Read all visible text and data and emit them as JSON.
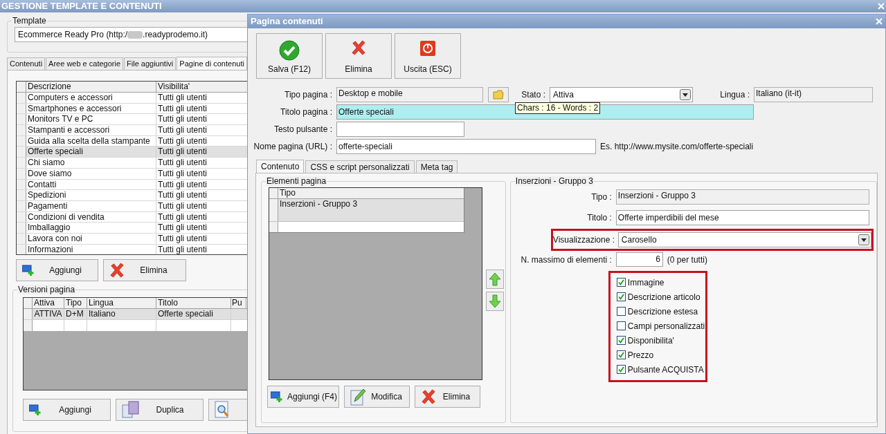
{
  "main_window": {
    "title": "GESTIONE TEMPLATE E CONTENUTI",
    "template": {
      "legend": "Template",
      "value_prefix": "Ecommerce Ready Pro (http:/",
      "value_suffix": ".readyprodemo.it)"
    },
    "tabs": [
      {
        "label": "Contenuti",
        "selected": false
      },
      {
        "label": "Aree web e categorie",
        "selected": false
      },
      {
        "label": "File aggiuntivi",
        "selected": false
      },
      {
        "label": "Pagine di contenuti",
        "selected": true
      }
    ],
    "pages_table": {
      "columns": [
        "Descrizione",
        "Visibilita'"
      ],
      "rows": [
        {
          "cells": [
            "Computers e accessori",
            "Tutti gli utenti"
          ],
          "selected": false
        },
        {
          "cells": [
            "Smartphones e accessori",
            "Tutti gli utenti"
          ],
          "selected": false
        },
        {
          "cells": [
            "Monitors TV e PC",
            "Tutti gli utenti"
          ],
          "selected": false
        },
        {
          "cells": [
            "Stampanti e accessori",
            "Tutti gli utenti"
          ],
          "selected": false
        },
        {
          "cells": [
            "Guida alla scelta della stampante",
            "Tutti gli utenti"
          ],
          "selected": false
        },
        {
          "cells": [
            "Offerte speciali",
            "Tutti gli utenti"
          ],
          "selected": true
        },
        {
          "cells": [
            "Chi siamo",
            "Tutti gli utenti"
          ],
          "selected": false
        },
        {
          "cells": [
            "Dove siamo",
            "Tutti gli utenti"
          ],
          "selected": false
        },
        {
          "cells": [
            "Contatti",
            "Tutti gli utenti"
          ],
          "selected": false
        },
        {
          "cells": [
            "Spedizioni",
            "Tutti gli utenti"
          ],
          "selected": false
        },
        {
          "cells": [
            "Pagamenti",
            "Tutti gli utenti"
          ],
          "selected": false
        },
        {
          "cells": [
            "Condizioni di vendita",
            "Tutti gli utenti"
          ],
          "selected": false
        },
        {
          "cells": [
            "Imballaggio",
            "Tutti gli utenti"
          ],
          "selected": false
        },
        {
          "cells": [
            "Lavora con noi",
            "Tutti gli utenti"
          ],
          "selected": false
        },
        {
          "cells": [
            "Informazioni",
            "Tutti gli utenti"
          ],
          "selected": false
        }
      ]
    },
    "page_buttons": [
      {
        "kind": "add",
        "label": "Aggiungi"
      },
      {
        "kind": "delete",
        "label": "Elimina"
      }
    ],
    "versions": {
      "legend": "Versioni pagina",
      "columns": [
        "Attiva",
        "Tipo",
        "Lingua",
        "Titolo",
        "Pu"
      ],
      "rows": [
        {
          "cells": [
            "ATTIVA",
            "D+M",
            "Italiano",
            "Offerte speciali"
          ],
          "selected": true
        }
      ]
    },
    "version_buttons": [
      {
        "kind": "add",
        "label": "Aggiungi"
      },
      {
        "kind": "duplicate",
        "label": "Duplica"
      },
      {
        "kind": "preview"
      }
    ]
  },
  "dialog": {
    "title": "Pagina contenuti",
    "toolbar": [
      {
        "kind": "save",
        "label": "Salva (F12)"
      },
      {
        "kind": "delete",
        "label": "Elimina"
      },
      {
        "kind": "exit",
        "label": "Uscita (ESC)"
      }
    ],
    "tipo_pagina": {
      "label": "Tipo pagina :",
      "value": "Desktop e mobile"
    },
    "stato": {
      "label": "Stato :",
      "value": "Attiva"
    },
    "lingua": {
      "label": "Lingua :",
      "value": "Italiano (it-it)"
    },
    "titolo_pagina": {
      "label": "Titolo pagina :",
      "value": "Offerte speciali"
    },
    "testo_pulsante": {
      "label": "Testo pulsante :"
    },
    "nome_pagina": {
      "label": "Nome pagina (URL) :",
      "value": "offerte-speciali",
      "hint": "Es. http://www.mysite.com/offerte-speciali"
    },
    "tooltip": "Chars : 16 - Words : 2",
    "tabs": [
      {
        "label": "Contenuto",
        "selected": true
      },
      {
        "label": "CSS e script personalizzati",
        "selected": false
      },
      {
        "label": "Meta tag",
        "selected": false
      }
    ],
    "elements": {
      "legend": "Elementi pagina",
      "column": "Tipo",
      "rows": [
        {
          "text": "Inserzioni - Gruppo 3",
          "selected": true
        }
      ],
      "buttons": [
        {
          "kind": "add",
          "label": "Aggiungi (F4)"
        },
        {
          "kind": "edit",
          "label": "Modifica"
        },
        {
          "kind": "delete",
          "label": "Elimina"
        }
      ]
    },
    "detail": {
      "legend": "Inserzioni - Gruppo 3",
      "tipo": {
        "label": "Tipo :",
        "value": "Inserzioni - Gruppo 3"
      },
      "titolo": {
        "label": "Titolo :",
        "value": "Offerte imperdibili del mese"
      },
      "visualizzazione": {
        "label": "Visualizzazione :",
        "value": "Carosello",
        "highlighted": true
      },
      "max_elements": {
        "label": "N. massimo di elementi :",
        "value": "6",
        "note": "(0 per tutti)"
      },
      "options_highlighted": true,
      "options": [
        {
          "label": "Immagine",
          "checked": true
        },
        {
          "label": "Descrizione articolo",
          "checked": true
        },
        {
          "label": "Descrizione estesa",
          "checked": false
        },
        {
          "label": "Campi personalizzati",
          "checked": false
        },
        {
          "label": "Disponibilita'",
          "checked": true
        },
        {
          "label": "Prezzo",
          "checked": true
        },
        {
          "label": "Pulsante ACQUISTA",
          "checked": true
        }
      ]
    }
  }
}
